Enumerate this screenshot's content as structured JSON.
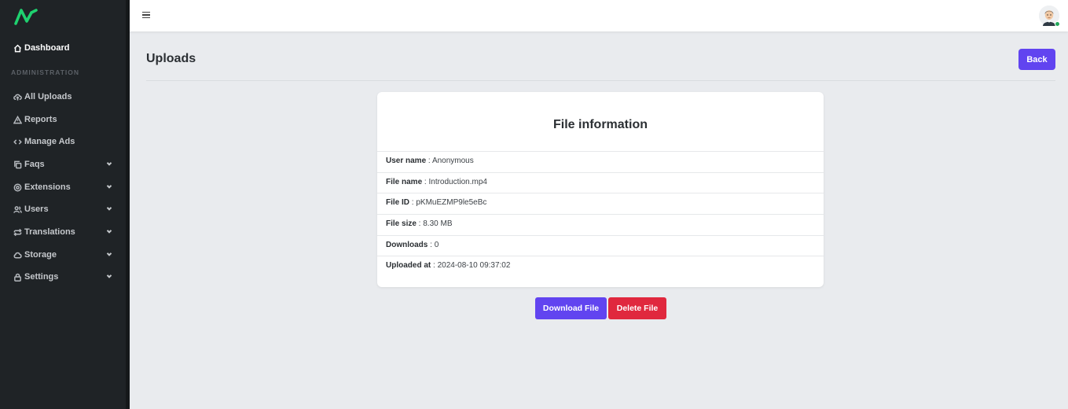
{
  "sidebar": {
    "section_label": "ADMINISTRATION",
    "items": [
      {
        "label": "Dashboard",
        "icon": "home-icon"
      },
      {
        "label": "All Uploads",
        "icon": "cloud-upload-icon"
      },
      {
        "label": "Reports",
        "icon": "warning-icon"
      },
      {
        "label": "Manage Ads",
        "icon": "code-icon"
      },
      {
        "label": "Faqs",
        "icon": "copy-icon"
      },
      {
        "label": "Extensions",
        "icon": "gear-icon"
      },
      {
        "label": "Users",
        "icon": "users-icon"
      },
      {
        "label": "Translations",
        "icon": "repeat-icon"
      },
      {
        "label": "Storage",
        "icon": "cloud-icon"
      },
      {
        "label": "Settings",
        "icon": "lock-icon"
      }
    ]
  },
  "header": {
    "title": "Uploads",
    "back_label": "Back"
  },
  "card": {
    "title": "File information",
    "rows": [
      {
        "label": "User name",
        "value": "Anonymous"
      },
      {
        "label": "File name",
        "value": "Introduction.mp4"
      },
      {
        "label": "File ID",
        "value": "pKMuEZMP9le5eBc"
      },
      {
        "label": "File size",
        "value": "8.30 MB"
      },
      {
        "label": "Downloads",
        "value": "0"
      },
      {
        "label": "Uploaded at",
        "value": "2024-08-10 09:37:02"
      }
    ]
  },
  "actions": {
    "download_label": "Download File",
    "delete_label": "Delete File"
  },
  "colors": {
    "primary": "#6144f0",
    "danger": "#e0283e",
    "sidebar_bg": "#1f2326",
    "logo_green": "#1fd16f"
  }
}
